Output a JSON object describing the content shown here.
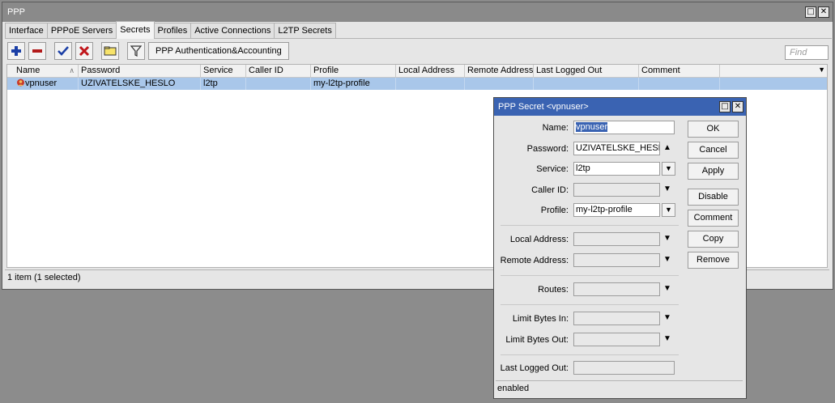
{
  "window": {
    "title": "PPP"
  },
  "tabs": [
    "Interface",
    "PPPoE Servers",
    "Secrets",
    "Profiles",
    "Active Connections",
    "L2TP Secrets"
  ],
  "active_tab": "Secrets",
  "toolbar": {
    "auth_button": "PPP Authentication&Accounting",
    "find_placeholder": "Find"
  },
  "table": {
    "columns": [
      "Name",
      "Password",
      "Service",
      "Caller ID",
      "Profile",
      "Local Address",
      "Remote Address",
      "Last Logged Out",
      "Comment"
    ],
    "rows": [
      {
        "name": "vpnuser",
        "password": "UZIVATELSKE_HESLO",
        "service": "l2tp",
        "caller_id": "",
        "profile": "my-l2tp-profile",
        "local_address": "",
        "remote_address": "",
        "last_logged_out": "",
        "comment": ""
      }
    ]
  },
  "status": "1 item (1 selected)",
  "dialog": {
    "title": "PPP Secret <vpnuser>",
    "labels": {
      "name": "Name:",
      "password": "Password:",
      "service": "Service:",
      "caller_id": "Caller ID:",
      "profile": "Profile:",
      "local_address": "Local Address:",
      "remote_address": "Remote Address:",
      "routes": "Routes:",
      "limit_in": "Limit Bytes In:",
      "limit_out": "Limit Bytes Out:",
      "last_logged_out": "Last Logged Out:"
    },
    "values": {
      "name": "vpnuser",
      "password": "UZIVATELSKE_HESLO",
      "service": "l2tp",
      "caller_id": "",
      "profile": "my-l2tp-profile",
      "local_address": "",
      "remote_address": "",
      "routes": "",
      "limit_in": "",
      "limit_out": "",
      "last_logged_out": ""
    },
    "buttons": [
      "OK",
      "Cancel",
      "Apply",
      "Disable",
      "Comment",
      "Copy",
      "Remove"
    ],
    "status": "enabled"
  }
}
